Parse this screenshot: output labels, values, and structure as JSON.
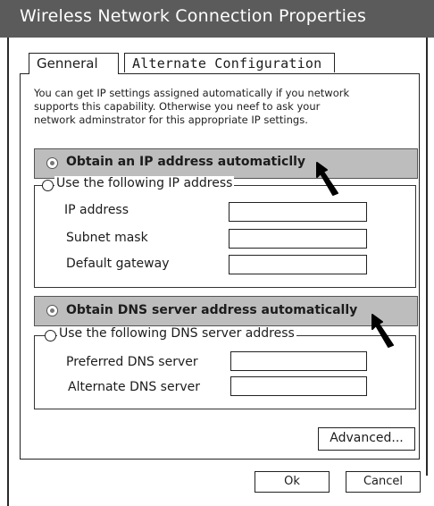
{
  "window": {
    "title": "Wireless Network Connection Properties"
  },
  "tabs": [
    {
      "label": "Genneral",
      "active": true
    },
    {
      "label": "Alternate Configuration",
      "active": false
    }
  ],
  "description": {
    "lines": [
      "You can get IP settings assigned automatically if you network",
      "supports this capability. Otherwise you neef to ask your",
      "network adminstrator for this appropriate IP settings."
    ]
  },
  "ip": {
    "auto_label": "Obtain an IP address automaticlly",
    "auto_selected": true,
    "manual_label": "Use the following IP address",
    "fields": [
      {
        "label": "IP address",
        "value": ""
      },
      {
        "label": "Subnet mask",
        "value": ""
      },
      {
        "label": "Default gateway",
        "value": ""
      }
    ]
  },
  "dns": {
    "auto_label": "Obtain DNS server address automatically",
    "auto_selected": true,
    "manual_label": "Use the following DNS server address",
    "fields": [
      {
        "label": "Preferred DNS server",
        "value": ""
      },
      {
        "label": "Alternate DNS server",
        "value": ""
      }
    ]
  },
  "buttons": {
    "advanced": "Advanced...",
    "ok": "Ok",
    "cancel": "Cancel"
  },
  "colors": {
    "title_bar": "#5b5b5b",
    "highlight": "#bdbdbd"
  },
  "icons": {
    "pointer": "mouse-pointer-icon"
  }
}
